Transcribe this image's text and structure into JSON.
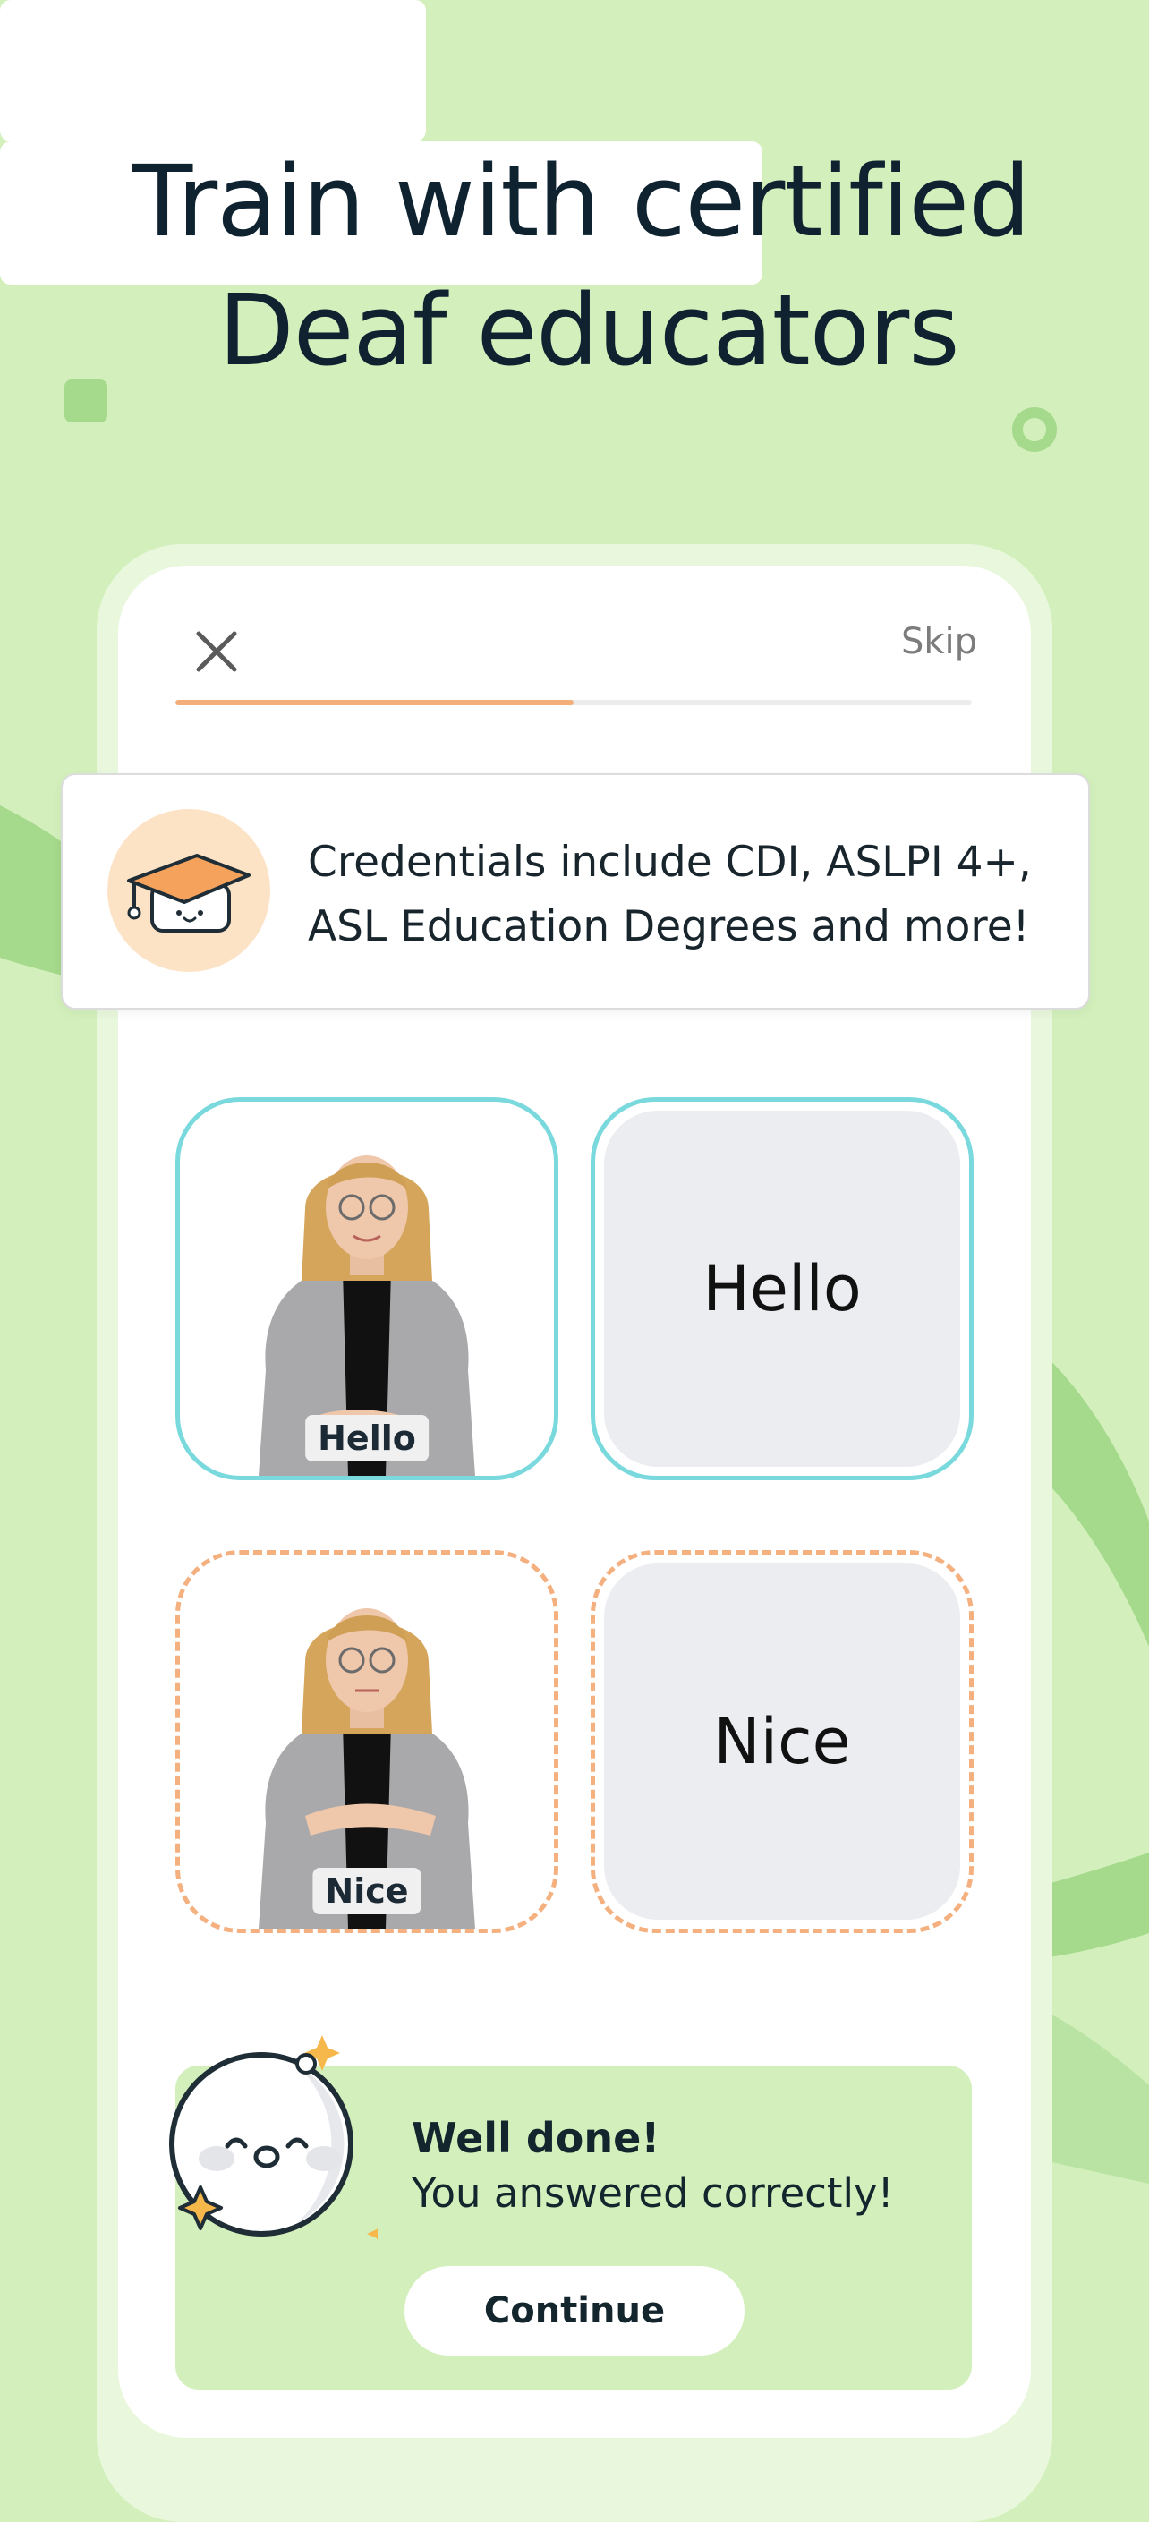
{
  "headline": {
    "line1_plain": "Train with",
    "line1_highlight": "certified",
    "line2_highlight": "Deaf educators"
  },
  "lesson": {
    "skip_label": "Skip",
    "progress_fraction": 0.5
  },
  "banner": {
    "icon": "graduation-cap-icon",
    "text": "Credentials include CDI, ASLPI 4+, ASL Education Degrees and more!"
  },
  "matches": [
    {
      "video_caption": "Hello",
      "word": "Hello",
      "state": "matched"
    },
    {
      "video_caption": "Nice",
      "word": "Nice",
      "state": "pending"
    }
  ],
  "feedback": {
    "title": "Well done!",
    "message": "You answered correctly!",
    "button_label": "Continue"
  },
  "colors": {
    "background": "#d3f0bc",
    "matched_border": "#7ad9dd",
    "pending_border": "#f4b07f",
    "progress": "#f4ae7a",
    "feedback_panel": "#d3f0bc"
  }
}
